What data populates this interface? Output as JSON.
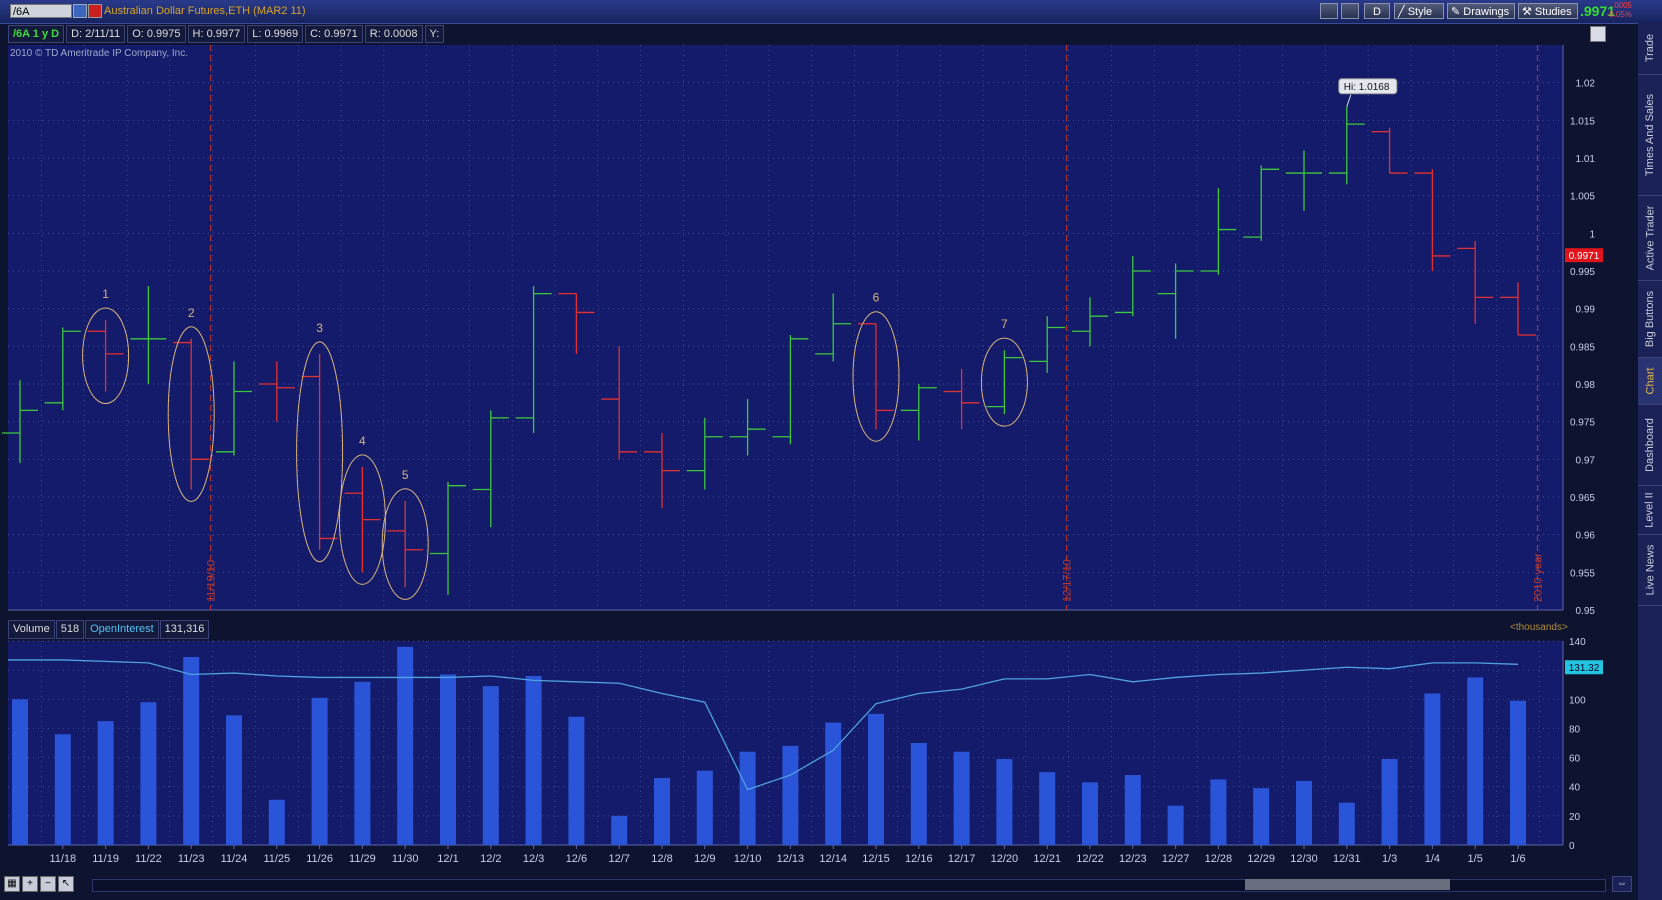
{
  "header": {
    "symbol": "/6A",
    "title": "Australian Dollar Futures,ETH (MAR2 11)",
    "last_price": ".9971",
    "net_change": ".0005",
    "pct_change": "-0.05%",
    "buttons": {
      "d": "D",
      "style": "Style",
      "drawings": "Drawings",
      "studies": "Studies"
    }
  },
  "info_bar": {
    "ticker_label": "/6A 1 y D",
    "date": "D: 2/11/11",
    "open": "O: 0.9975",
    "high": "H: 0.9977",
    "low": "L: 0.9969",
    "close": "C: 0.9971",
    "range": "R: 0.0008",
    "y": "Y:"
  },
  "copyright": "2010 © TD Ameritrade IP Company, Inc.",
  "side_tabs": [
    "Trade",
    "Times And Sales",
    "Active Trader",
    "Big Buttons",
    "Chart",
    "Dashboard",
    "Level II",
    "Live News"
  ],
  "volume_header": {
    "volume_label": "Volume",
    "volume_value": "518",
    "oi_label": "OpenInterest",
    "oi_value": "131,316",
    "units": "<thousands>"
  },
  "colors": {
    "background": "#151b6b",
    "up": "#3cc83c",
    "down": "#e33030",
    "volume": "#2b55d9",
    "open_interest": "#4fa3e0",
    "ellipse": "#d8b37a",
    "marker": "#c0392b"
  },
  "chart_data": [
    {
      "type": "ohlc",
      "ylim": [
        0.95,
        1.025
      ],
      "y_ticks": [
        "0.95",
        "0.955",
        "0.96",
        "0.965",
        "0.97",
        "0.975",
        "0.98",
        "0.985",
        "0.99",
        "0.995",
        "1",
        "1.005",
        "1.01",
        "1.015",
        "1.02"
      ],
      "x_ticks": [
        "11/18",
        "11/19",
        "11/22",
        "11/23",
        "11/24",
        "11/25",
        "11/26",
        "11/29",
        "11/30",
        "12/1",
        "12/2",
        "12/3",
        "12/6",
        "12/7",
        "12/8",
        "12/9",
        "12/10",
        "12/13",
        "12/14",
        "12/15",
        "12/16",
        "12/17",
        "12/20",
        "12/21",
        "12/22",
        "12/23",
        "12/27",
        "12/28",
        "12/29",
        "12/30",
        "12/31",
        "1/3",
        "1/4",
        "1/5",
        "1/6"
      ],
      "bars": [
        {
          "date": "11/17",
          "o": 0.9735,
          "h": 0.9805,
          "l": 0.9695,
          "c": 0.9765
        },
        {
          "date": "11/18",
          "o": 0.9775,
          "h": 0.9875,
          "l": 0.9765,
          "c": 0.987
        },
        {
          "date": "11/19",
          "o": 0.987,
          "h": 0.9885,
          "l": 0.979,
          "c": 0.984
        },
        {
          "date": "11/22",
          "o": 0.986,
          "h": 0.993,
          "l": 0.98,
          "c": 0.986
        },
        {
          "date": "11/23",
          "o": 0.9855,
          "h": 0.986,
          "l": 0.966,
          "c": 0.97
        },
        {
          "date": "11/24",
          "o": 0.971,
          "h": 0.983,
          "l": 0.9705,
          "c": 0.979
        },
        {
          "date": "11/25",
          "o": 0.98,
          "h": 0.983,
          "l": 0.975,
          "c": 0.9795
        },
        {
          "date": "11/26",
          "o": 0.981,
          "h": 0.984,
          "l": 0.958,
          "c": 0.9595
        },
        {
          "date": "11/29",
          "o": 0.9655,
          "h": 0.969,
          "l": 0.955,
          "c": 0.962
        },
        {
          "date": "11/30",
          "o": 0.9605,
          "h": 0.9645,
          "l": 0.953,
          "c": 0.958
        },
        {
          "date": "12/1",
          "o": 0.9575,
          "h": 0.967,
          "l": 0.952,
          "c": 0.9665
        },
        {
          "date": "12/2",
          "o": 0.966,
          "h": 0.9765,
          "l": 0.961,
          "c": 0.9755
        },
        {
          "date": "12/3",
          "o": 0.9755,
          "h": 0.993,
          "l": 0.9735,
          "c": 0.992
        },
        {
          "date": "12/6",
          "o": 0.992,
          "h": 0.992,
          "l": 0.984,
          "c": 0.9895
        },
        {
          "date": "12/7",
          "o": 0.978,
          "h": 0.985,
          "l": 0.97,
          "c": 0.971
        },
        {
          "date": "12/8",
          "o": 0.971,
          "h": 0.9735,
          "l": 0.9635,
          "c": 0.9685
        },
        {
          "date": "12/9",
          "o": 0.9685,
          "h": 0.9755,
          "l": 0.966,
          "c": 0.973
        },
        {
          "date": "12/10",
          "o": 0.973,
          "h": 0.978,
          "l": 0.9705,
          "c": 0.974
        },
        {
          "date": "12/13",
          "o": 0.973,
          "h": 0.9865,
          "l": 0.972,
          "c": 0.986
        },
        {
          "date": "12/14",
          "o": 0.984,
          "h": 0.992,
          "l": 0.983,
          "c": 0.988
        },
        {
          "date": "12/15",
          "o": 0.988,
          "h": 0.988,
          "l": 0.974,
          "c": 0.9765
        },
        {
          "date": "12/16",
          "o": 0.9765,
          "h": 0.98,
          "l": 0.9725,
          "c": 0.9795
        },
        {
          "date": "12/17",
          "o": 0.979,
          "h": 0.982,
          "l": 0.974,
          "c": 0.9775
        },
        {
          "date": "12/20",
          "o": 0.977,
          "h": 0.9845,
          "l": 0.976,
          "c": 0.9835
        },
        {
          "date": "12/21",
          "o": 0.983,
          "h": 0.989,
          "l": 0.9815,
          "c": 0.9875
        },
        {
          "date": "12/22",
          "o": 0.987,
          "h": 0.9915,
          "l": 0.985,
          "c": 0.989
        },
        {
          "date": "12/23",
          "o": 0.9895,
          "h": 0.997,
          "l": 0.989,
          "c": 0.995
        },
        {
          "date": "12/27",
          "o": 0.992,
          "h": 0.996,
          "l": 0.986,
          "c": 0.995
        },
        {
          "date": "12/28",
          "o": 0.995,
          "h": 1.006,
          "l": 0.9945,
          "c": 1.0005
        },
        {
          "date": "12/29",
          "o": 0.9995,
          "h": 1.009,
          "l": 0.999,
          "c": 1.0085
        },
        {
          "date": "12/30",
          "o": 1.008,
          "h": 1.011,
          "l": 1.003,
          "c": 1.008
        },
        {
          "date": "12/31",
          "o": 1.008,
          "h": 1.0168,
          "l": 1.0065,
          "c": 1.0145
        },
        {
          "date": "1/3",
          "o": 1.0135,
          "h": 1.014,
          "l": 1.008,
          "c": 1.008
        },
        {
          "date": "1/4",
          "o": 1.008,
          "h": 1.0085,
          "l": 0.995,
          "c": 0.997
        },
        {
          "date": "1/5",
          "o": 0.998,
          "h": 0.999,
          "l": 0.988,
          "c": 0.9915
        },
        {
          "date": "1/6",
          "o": 0.9915,
          "h": 0.9935,
          "l": 0.9865,
          "c": 0.9865
        }
      ],
      "high_label": "Hi: 1.0168",
      "last_label": "0.9971",
      "vertical_markers": [
        {
          "label": "11/19/10",
          "after_index": 4
        },
        {
          "label": "12/17/10",
          "after_index": 24
        },
        {
          "label": "2010 year",
          "after_index": 35
        }
      ],
      "annotations": [
        {
          "label": "1",
          "bar_index": 2
        },
        {
          "label": "2",
          "bar_index": 4
        },
        {
          "label": "3",
          "bar_index": 7
        },
        {
          "label": "4",
          "bar_index": 8
        },
        {
          "label": "5",
          "bar_index": 9
        },
        {
          "label": "6",
          "bar_index": 20
        },
        {
          "label": "7",
          "bar_index": 23
        }
      ]
    },
    {
      "type": "bar",
      "ylim": [
        0,
        140
      ],
      "y_ticks": [
        "0",
        "20",
        "40",
        "60",
        "80",
        "100",
        "120",
        "140"
      ],
      "volume": [
        100,
        76,
        85,
        98,
        129,
        89,
        31,
        101,
        112,
        136,
        117,
        109,
        116,
        88,
        20,
        46,
        51,
        64,
        68,
        84,
        90,
        70,
        64,
        59,
        50,
        43,
        48,
        27,
        45,
        39,
        44,
        29,
        59,
        104,
        115,
        99
      ],
      "open_interest": [
        127,
        127,
        126,
        125,
        117,
        118,
        116,
        115,
        115,
        115,
        115,
        116,
        113,
        112,
        111,
        104,
        98,
        38,
        48,
        65,
        97,
        104,
        107,
        114,
        114,
        117,
        112,
        115,
        117,
        118,
        120,
        122,
        121,
        125,
        125,
        124
      ],
      "open_interest_label": "131.32"
    }
  ]
}
